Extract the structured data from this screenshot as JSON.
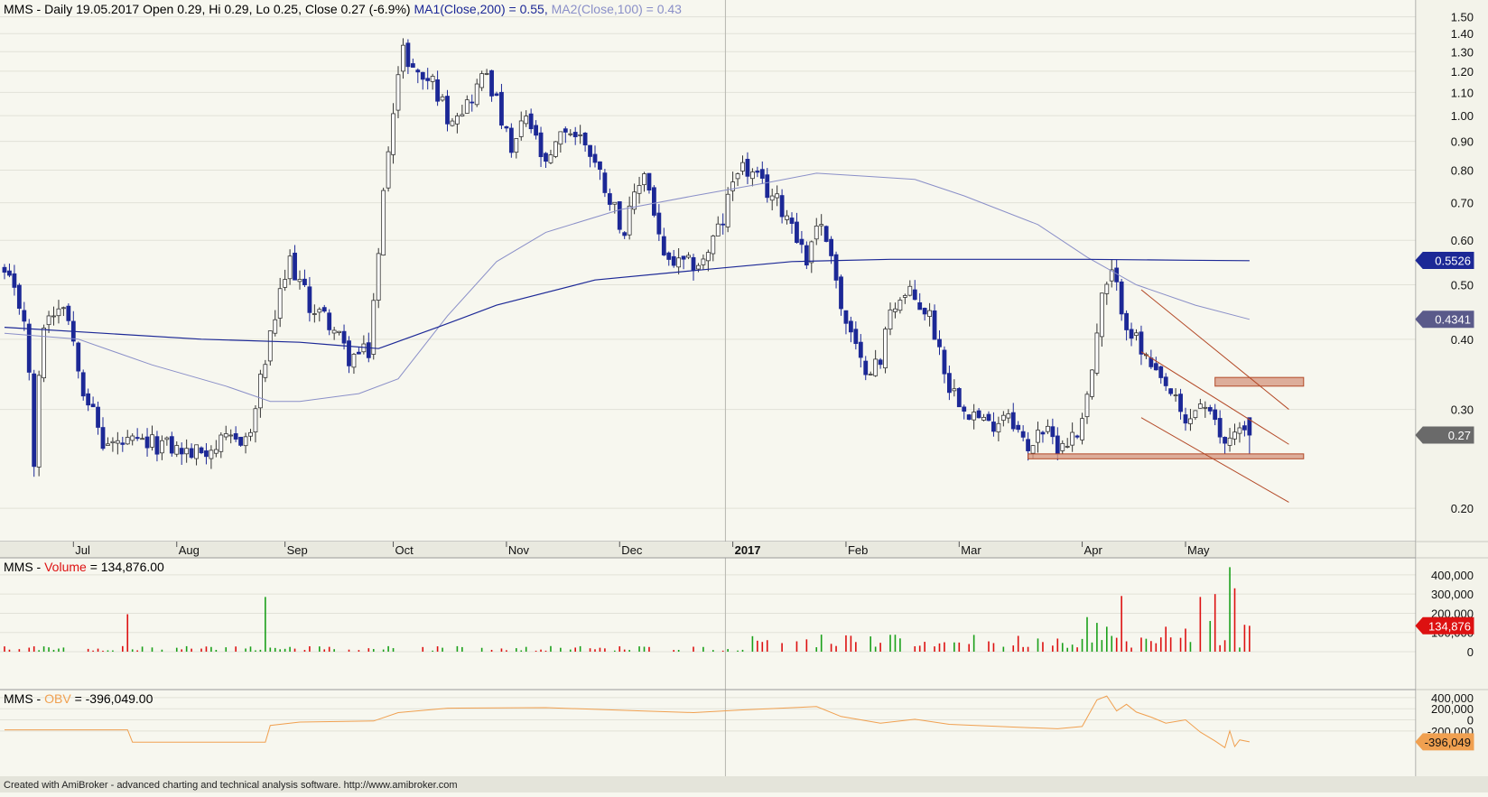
{
  "header": {
    "main_prefix": "MMS - Daily 19.05.2017 Open 0.29, Hi 0.29, Lo 0.25, Close 0.27 (-6.9%)",
    "ma1": "MA1(Close,200) = 0.55,",
    "ma2": "MA2(Close,100) = 0.43",
    "volume_prefix": "MMS -",
    "volume_name": "Volume",
    "volume_value": "= 134,876.00",
    "obv_prefix": "MMS -",
    "obv_name": "OBV",
    "obv_value": "= -396,049.00"
  },
  "footer": "Created with AmiBroker - advanced charting and technical analysis software. http://www.amibroker.com",
  "colors": {
    "background": "#f7f7ef",
    "candle": "#1c2896",
    "ma200": "#1c2896",
    "ma100": "#8a8fc8",
    "volume_up": "#1aa01a",
    "volume_down": "#dd1111",
    "obv": "#f0a050",
    "trendline": "#b44a28",
    "zone_fill": "#d69a84"
  },
  "badges": {
    "ma200": "0.5526",
    "ma100": "0.4341",
    "close": "0.27",
    "volume": "134,876",
    "obv": "-396,049"
  },
  "chart_data": [
    {
      "type": "candlestick",
      "title": "MMS - Daily 19.05.2017",
      "yscale": "log",
      "ylim": [
        0.195,
        1.56
      ],
      "y_ticks": [
        {
          "v": 1.5,
          "label": "1.50"
        },
        {
          "v": 1.4,
          "label": "1.40"
        },
        {
          "v": 1.3,
          "label": "1.30"
        },
        {
          "v": 1.2,
          "label": "1.20"
        },
        {
          "v": 1.1,
          "label": "1.10"
        },
        {
          "v": 1.0,
          "label": "1.00"
        },
        {
          "v": 0.9,
          "label": "0.90"
        },
        {
          "v": 0.8,
          "label": "0.80"
        },
        {
          "v": 0.7,
          "label": "0.70"
        },
        {
          "v": 0.6,
          "label": "0.60"
        },
        {
          "v": 0.5,
          "label": "0.50"
        },
        {
          "v": 0.4,
          "label": "0.40"
        },
        {
          "v": 0.3,
          "label": "0.30"
        },
        {
          "v": 0.2,
          "label": "0.20"
        }
      ],
      "month_labels": [
        {
          "label": "Jul",
          "idx": 14
        },
        {
          "label": "Aug",
          "idx": 35
        },
        {
          "label": "Sep",
          "idx": 57
        },
        {
          "label": "Oct",
          "idx": 79
        },
        {
          "label": "Nov",
          "idx": 102
        },
        {
          "label": "Dec",
          "idx": 125
        },
        {
          "label": "2017",
          "idx": 148,
          "bold": true
        },
        {
          "label": "Feb",
          "idx": 171
        },
        {
          "label": "Mar",
          "idx": 194
        },
        {
          "label": "Apr",
          "idx": 219
        },
        {
          "label": "May",
          "idx": 240
        }
      ],
      "year_divider_idx": 146.5,
      "kp": [
        [
          0,
          0.52
        ],
        [
          4,
          0.44
        ],
        [
          6,
          0.24
        ],
        [
          8,
          0.43
        ],
        [
          12,
          0.47
        ],
        [
          16,
          0.33
        ],
        [
          20,
          0.26
        ],
        [
          26,
          0.26
        ],
        [
          32,
          0.26
        ],
        [
          38,
          0.25
        ],
        [
          44,
          0.26
        ],
        [
          50,
          0.27
        ],
        [
          54,
          0.4
        ],
        [
          58,
          0.55
        ],
        [
          62,
          0.46
        ],
        [
          66,
          0.43
        ],
        [
          70,
          0.37
        ],
        [
          74,
          0.38
        ],
        [
          76,
          0.56
        ],
        [
          79,
          1.05
        ],
        [
          81,
          1.3
        ],
        [
          84,
          1.18
        ],
        [
          87,
          1.15
        ],
        [
          90,
          1.0
        ],
        [
          94,
          1.05
        ],
        [
          98,
          1.2
        ],
        [
          100,
          1.05
        ],
        [
          103,
          0.85
        ],
        [
          106,
          1.0
        ],
        [
          110,
          0.8
        ],
        [
          114,
          0.95
        ],
        [
          118,
          0.9
        ],
        [
          122,
          0.75
        ],
        [
          126,
          0.62
        ],
        [
          130,
          0.8
        ],
        [
          134,
          0.55
        ],
        [
          138,
          0.54
        ],
        [
          142,
          0.55
        ],
        [
          146,
          0.65
        ],
        [
          149,
          0.82
        ],
        [
          152,
          0.78
        ],
        [
          156,
          0.72
        ],
        [
          160,
          0.65
        ],
        [
          163,
          0.55
        ],
        [
          165,
          0.65
        ],
        [
          168,
          0.58
        ],
        [
          170,
          0.45
        ],
        [
          174,
          0.36
        ],
        [
          178,
          0.36
        ],
        [
          180,
          0.46
        ],
        [
          184,
          0.48
        ],
        [
          188,
          0.44
        ],
        [
          192,
          0.33
        ],
        [
          196,
          0.3
        ],
        [
          200,
          0.28
        ],
        [
          204,
          0.3
        ],
        [
          208,
          0.25
        ],
        [
          210,
          0.28
        ],
        [
          214,
          0.26
        ],
        [
          218,
          0.27
        ],
        [
          221,
          0.35
        ],
        [
          223,
          0.47
        ],
        [
          225,
          0.52
        ],
        [
          228,
          0.43
        ],
        [
          231,
          0.38
        ],
        [
          234,
          0.34
        ],
        [
          237,
          0.32
        ],
        [
          240,
          0.28
        ],
        [
          243,
          0.31
        ],
        [
          246,
          0.28
        ],
        [
          248,
          0.26
        ],
        [
          250,
          0.28
        ],
        [
          253,
          0.27
        ]
      ],
      "ma200": [
        [
          0,
          0.42
        ],
        [
          20,
          0.41
        ],
        [
          40,
          0.4
        ],
        [
          60,
          0.395
        ],
        [
          76,
          0.385
        ],
        [
          88,
          0.42
        ],
        [
          100,
          0.46
        ],
        [
          120,
          0.51
        ],
        [
          140,
          0.53
        ],
        [
          160,
          0.55
        ],
        [
          180,
          0.555
        ],
        [
          200,
          0.555
        ],
        [
          220,
          0.555
        ],
        [
          240,
          0.553
        ],
        [
          253,
          0.552
        ]
      ],
      "ma100": [
        [
          0,
          0.41
        ],
        [
          15,
          0.4
        ],
        [
          30,
          0.36
        ],
        [
          45,
          0.33
        ],
        [
          54,
          0.31
        ],
        [
          60,
          0.31
        ],
        [
          72,
          0.32
        ],
        [
          80,
          0.34
        ],
        [
          90,
          0.44
        ],
        [
          100,
          0.55
        ],
        [
          110,
          0.62
        ],
        [
          125,
          0.68
        ],
        [
          140,
          0.72
        ],
        [
          155,
          0.76
        ],
        [
          165,
          0.79
        ],
        [
          175,
          0.78
        ],
        [
          185,
          0.77
        ],
        [
          195,
          0.72
        ],
        [
          210,
          0.64
        ],
        [
          220,
          0.56
        ],
        [
          230,
          0.5
        ],
        [
          242,
          0.46
        ],
        [
          253,
          0.434
        ]
      ],
      "trendlines": [
        {
          "x1": 231,
          "y1": 0.49,
          "x2": 261,
          "y2": 0.3
        },
        {
          "x1": 231,
          "y1": 0.38,
          "x2": 261,
          "y2": 0.26
        },
        {
          "x1": 231,
          "y1": 0.29,
          "x2": 261,
          "y2": 0.205
        }
      ],
      "zones": [
        {
          "x1": 246,
          "x2": 264,
          "y_low": 0.33,
          "y_high": 0.342
        },
        {
          "x1": 208,
          "x2": 264,
          "y_low": 0.245,
          "y_high": 0.25
        }
      ]
    },
    {
      "type": "bar",
      "title": "Volume",
      "ylim": [
        0,
        470000
      ],
      "y_ticks": [
        {
          "v": 400000,
          "label": "400,000"
        },
        {
          "v": 300000,
          "label": "300,000"
        },
        {
          "v": 200000,
          "label": "200,000"
        },
        {
          "v": 100000,
          "label": "100,000"
        },
        {
          "v": 0,
          "label": "0"
        }
      ],
      "last_value": 134876,
      "spikes": [
        {
          "idx": 25,
          "v": 195000,
          "color": "down"
        },
        {
          "idx": 53,
          "v": 285000,
          "color": "up"
        },
        {
          "idx": 227,
          "v": 290000,
          "color": "down"
        },
        {
          "idx": 243,
          "v": 285000,
          "color": "down"
        },
        {
          "idx": 246,
          "v": 300000,
          "color": "down"
        },
        {
          "idx": 249,
          "v": 440000,
          "color": "up"
        },
        {
          "idx": 250,
          "v": 330000,
          "color": "down"
        },
        {
          "idx": 252,
          "v": 140000,
          "color": "down"
        },
        {
          "idx": 222,
          "v": 150000,
          "color": "up"
        },
        {
          "idx": 224,
          "v": 130000,
          "color": "up"
        },
        {
          "idx": 220,
          "v": 180000,
          "color": "up"
        },
        {
          "idx": 245,
          "v": 160000,
          "color": "up"
        },
        {
          "idx": 240,
          "v": 120000,
          "color": "down"
        },
        {
          "idx": 236,
          "v": 130000,
          "color": "down"
        }
      ]
    },
    {
      "type": "line",
      "title": "OBV",
      "ylim": [
        -560000,
        480000
      ],
      "y_ticks": [
        {
          "v": 400000,
          "label": "400,000"
        },
        {
          "v": 200000,
          "label": "200,000"
        },
        {
          "v": 0,
          "label": "0"
        },
        {
          "v": -200000,
          "label": "-200,000"
        }
      ],
      "points": [
        [
          0,
          -180000
        ],
        [
          25,
          -180000
        ],
        [
          26,
          -400000
        ],
        [
          53,
          -400000
        ],
        [
          54,
          -100000
        ],
        [
          60,
          -40000
        ],
        [
          75,
          -20000
        ],
        [
          80,
          130000
        ],
        [
          90,
          210000
        ],
        [
          110,
          220000
        ],
        [
          130,
          160000
        ],
        [
          140,
          130000
        ],
        [
          150,
          180000
        ],
        [
          165,
          240000
        ],
        [
          170,
          60000
        ],
        [
          178,
          -60000
        ],
        [
          185,
          10000
        ],
        [
          192,
          -80000
        ],
        [
          205,
          -130000
        ],
        [
          214,
          -160000
        ],
        [
          219,
          -120000
        ],
        [
          222,
          360000
        ],
        [
          224,
          430000
        ],
        [
          226,
          160000
        ],
        [
          228,
          280000
        ],
        [
          230,
          140000
        ],
        [
          233,
          50000
        ],
        [
          236,
          -60000
        ],
        [
          240,
          0
        ],
        [
          243,
          -220000
        ],
        [
          246,
          -380000
        ],
        [
          248,
          -500000
        ],
        [
          249,
          -200000
        ],
        [
          250,
          -480000
        ],
        [
          251,
          -360000
        ],
        [
          253,
          -396049
        ]
      ]
    }
  ]
}
